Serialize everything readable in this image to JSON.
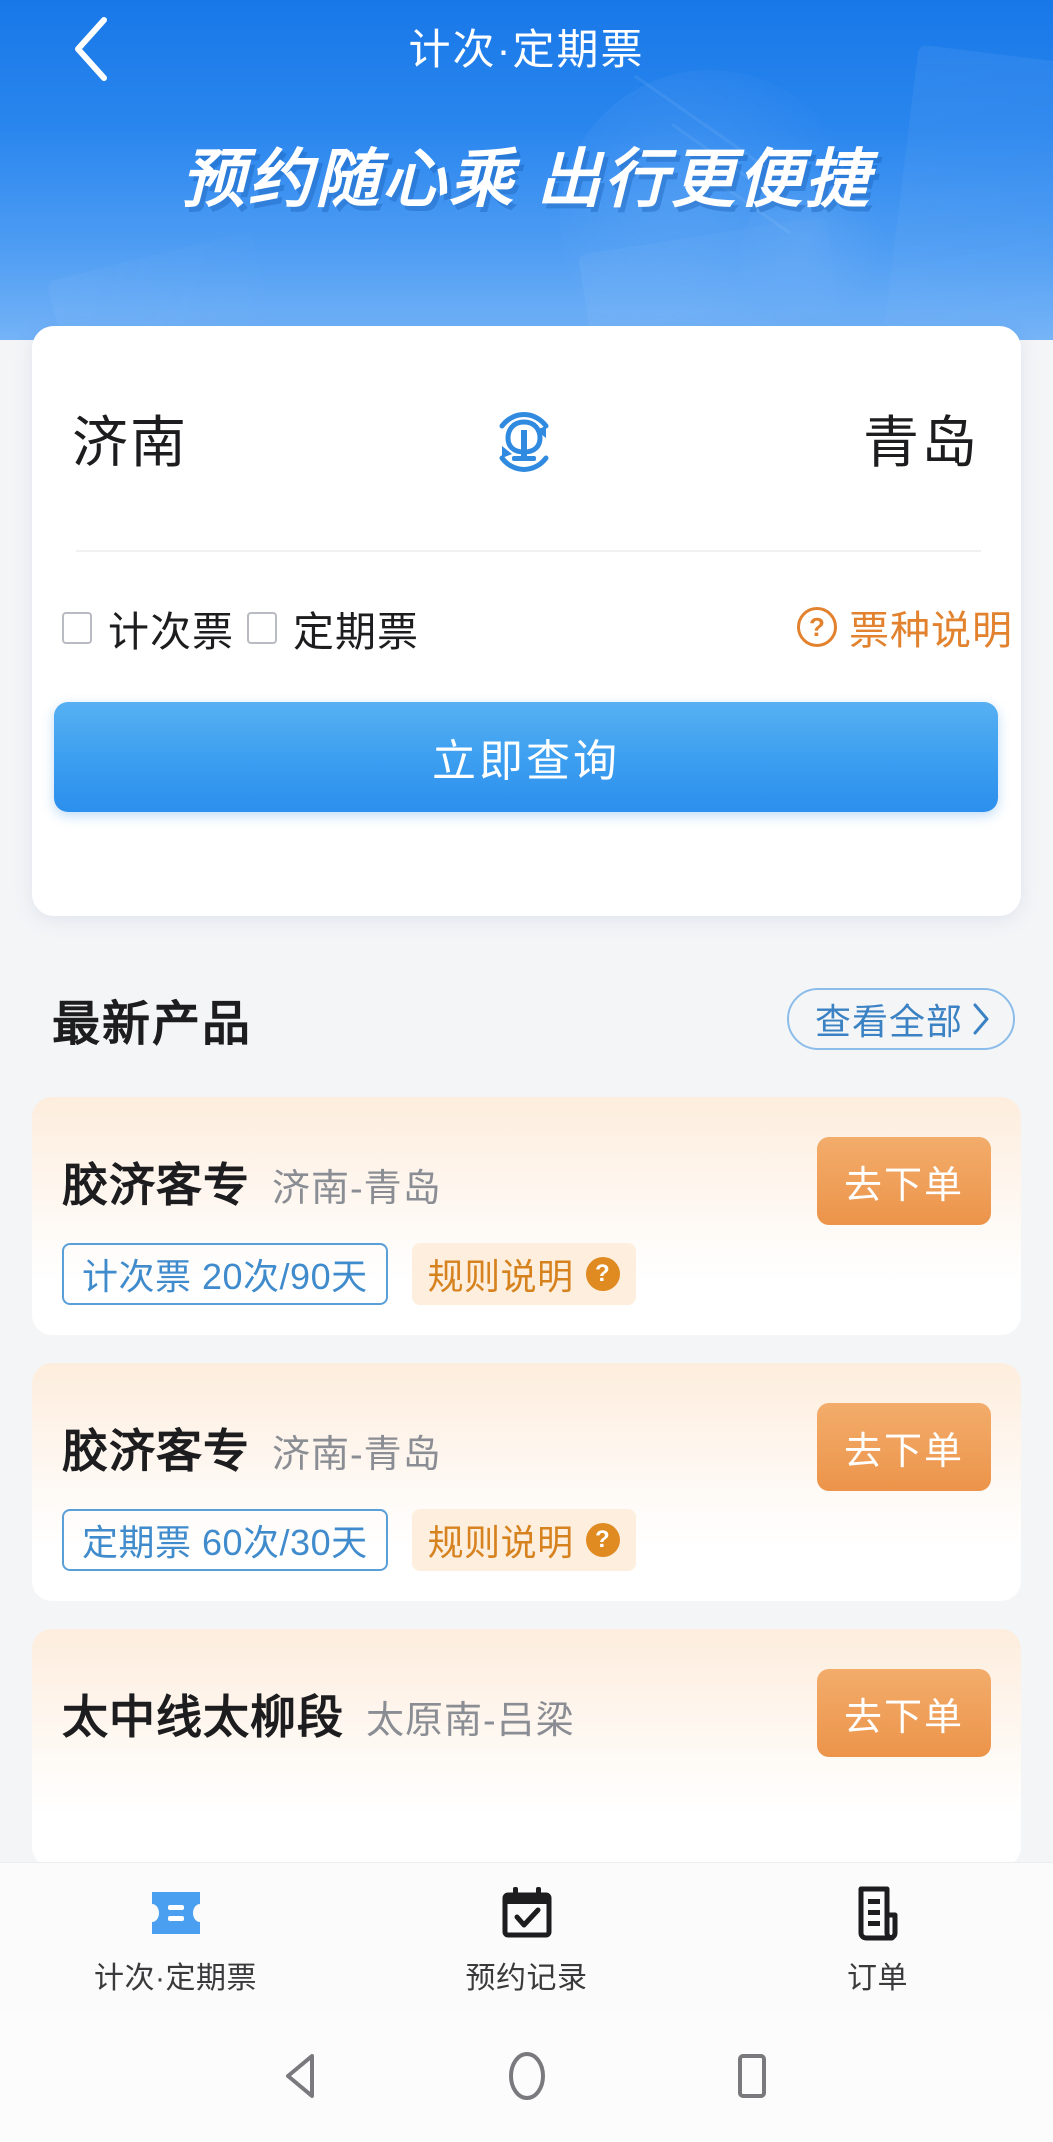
{
  "header": {
    "title": "计次·定期票",
    "back_icon": "chevron-left-icon",
    "slogan": "预约随心乘 出行更便捷"
  },
  "search": {
    "from_city": "济南",
    "to_city": "青岛",
    "swap_icon": "railway-swap-icon",
    "options": [
      {
        "label": "计次票",
        "checked": false
      },
      {
        "label": "定期票",
        "checked": false
      }
    ],
    "help_label": "票种说明",
    "help_icon": "question-circle-icon",
    "query_label": "立即查询",
    "accent_blue": "#2b8fed",
    "accent_orange": "#e2822e"
  },
  "products": {
    "section_title": "最新产品",
    "view_all_label": "查看全部",
    "view_all_icon": "chevron-right-icon",
    "rule_label": "规则说明",
    "rule_icon": "question-circle-filled-icon",
    "order_label": "去下单",
    "items": [
      {
        "name": "胶济客专",
        "route": "济南-青岛",
        "tag": "计次票 20次/90天",
        "rule_label": "规则说明",
        "order_label": "去下单"
      },
      {
        "name": "胶济客专",
        "route": "济南-青岛",
        "tag": "定期票 60次/30天",
        "rule_label": "规则说明",
        "order_label": "去下单"
      },
      {
        "name": "太中线太柳段",
        "route": "太原南-吕梁",
        "tag": "",
        "rule_label": "",
        "order_label": "去下单"
      }
    ]
  },
  "tabbar": {
    "active_color": "#4a9ff0",
    "items": [
      {
        "label": "计次·定期票",
        "icon": "ticket-icon",
        "active": true
      },
      {
        "label": "预约记录",
        "icon": "calendar-check-icon",
        "active": false
      },
      {
        "label": "订单",
        "icon": "receipt-icon",
        "active": false
      }
    ]
  },
  "androidnav": {
    "back_icon": "triangle-back-icon",
    "home_icon": "circle-home-icon",
    "recents_icon": "square-recents-icon"
  }
}
